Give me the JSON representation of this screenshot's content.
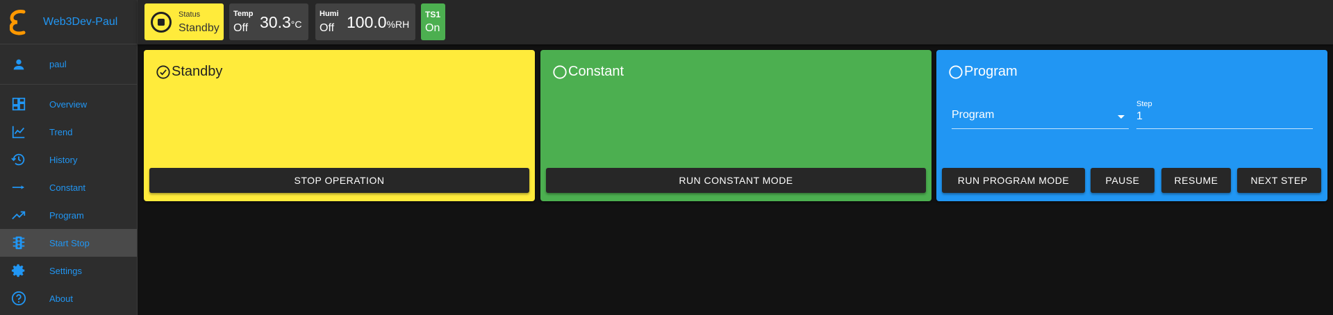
{
  "app": {
    "title": "Web3Dev-Paul"
  },
  "user": {
    "name": "paul"
  },
  "nav": [
    {
      "label": "Overview",
      "icon": "dashboard-icon"
    },
    {
      "label": "Trend",
      "icon": "chart-line-icon"
    },
    {
      "label": "History",
      "icon": "history-icon"
    },
    {
      "label": "Constant",
      "icon": "arrow-right-icon"
    },
    {
      "label": "Program",
      "icon": "trending-up-icon"
    },
    {
      "label": "Start Stop",
      "icon": "traffic-light-icon",
      "active": true
    },
    {
      "label": "Settings",
      "icon": "gear-icon"
    },
    {
      "label": "About",
      "icon": "help-circle-icon"
    }
  ],
  "status": {
    "label": "Status",
    "value": "Standby"
  },
  "temp": {
    "label": "Temp",
    "state": "Off",
    "value": "30.3",
    "unit": "°C"
  },
  "humi": {
    "label": "Humi",
    "state": "Off",
    "value": "100.0",
    "unit": "%RH"
  },
  "ts1": {
    "label": "TS1",
    "state": "On"
  },
  "cards": {
    "standby": {
      "title": "Standby",
      "button": "STOP OPERATION",
      "selected": true
    },
    "constant": {
      "title": "Constant",
      "button": "RUN CONSTANT MODE",
      "selected": false
    },
    "program": {
      "title": "Program",
      "selected": false,
      "select_value": "Program",
      "step_label": "Step",
      "step_value": "1",
      "buttons": {
        "run": "RUN PROGRAM MODE",
        "pause": "PAUSE",
        "resume": "RESUME",
        "next": "NEXT STEP"
      }
    }
  },
  "colors": {
    "accent": "#2196f3",
    "standby": "#ffeb3b",
    "constant": "#4caf50",
    "program": "#2196f3"
  }
}
